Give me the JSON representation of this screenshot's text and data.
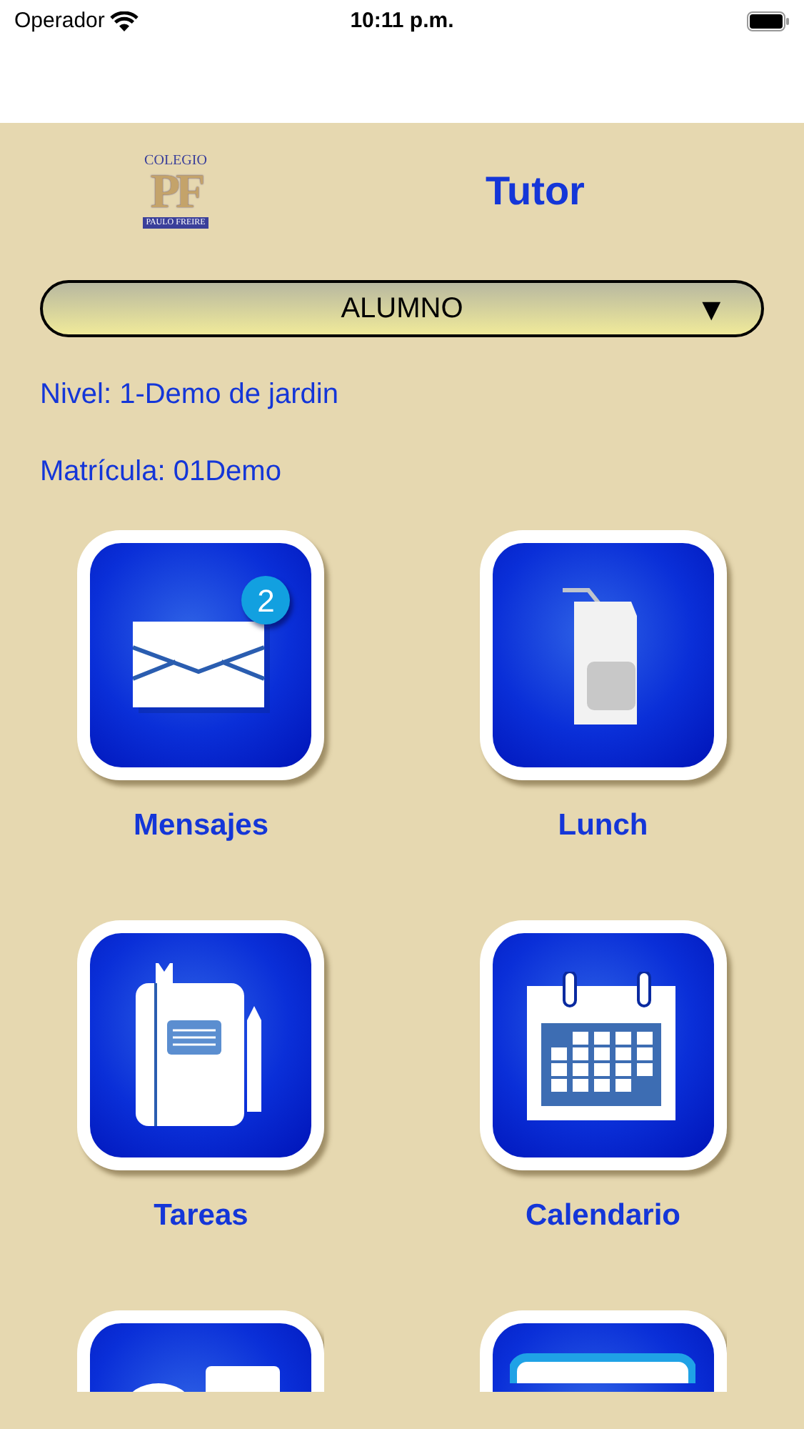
{
  "status_bar": {
    "carrier": "Operador",
    "time": "10:11 p.m."
  },
  "header": {
    "logo": {
      "top": "COLEGIO",
      "mark": "PF",
      "bottom": "PAULO FREIRE"
    },
    "title": "Tutor"
  },
  "role_select": {
    "value": "ALUMNO",
    "arrow": "▼"
  },
  "info": [
    "Nivel: 1-Demo de jardin",
    "Matrícula: 01Demo"
  ],
  "tiles": [
    {
      "kind": "mail",
      "label": "Mensajes",
      "badge": "2"
    },
    {
      "kind": "milk",
      "label": "Lunch"
    },
    {
      "kind": "notebook",
      "label": "Tareas"
    },
    {
      "kind": "calendar",
      "label": "Calendario"
    },
    {
      "kind": "cards"
    },
    {
      "kind": "screen"
    }
  ]
}
